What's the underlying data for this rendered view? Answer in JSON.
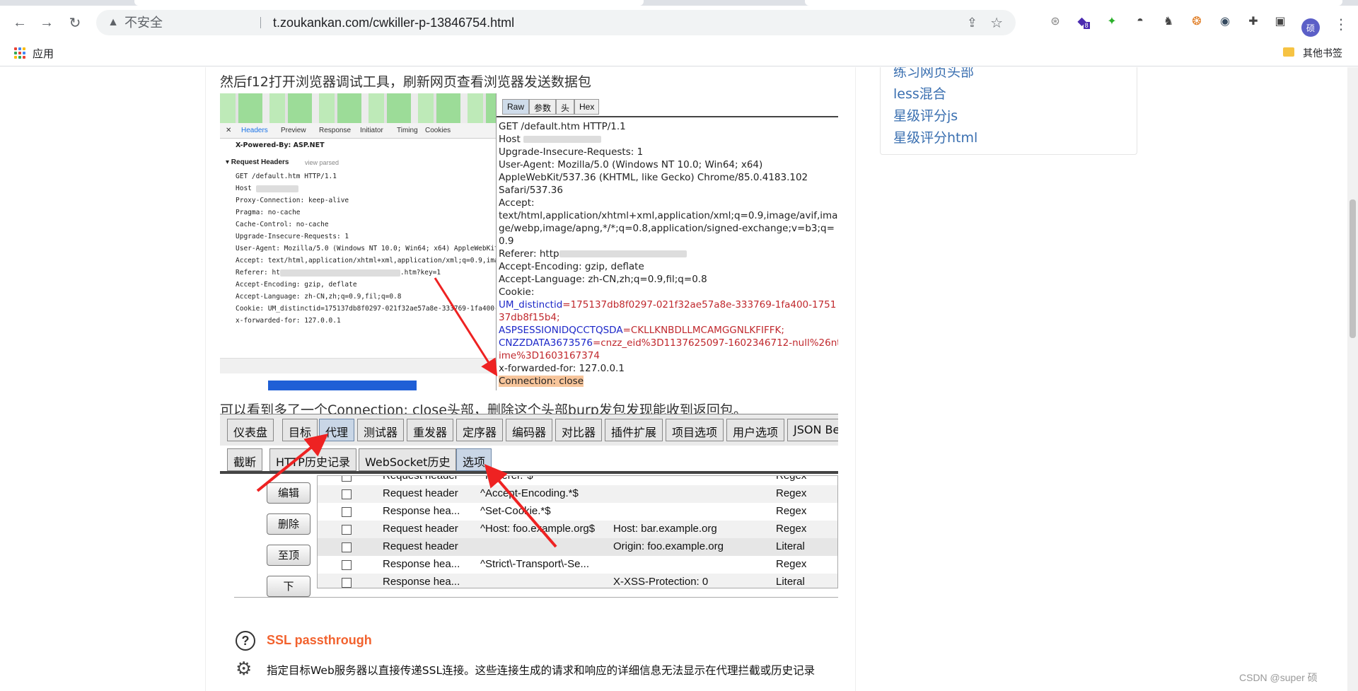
{
  "browser": {
    "insecure_label": "不安全",
    "url": "t.zoukankan.com/cwkiller-p-13846754.html",
    "apps_label": "应用",
    "other_bookmarks": "其他书签",
    "profile_initial": "硕",
    "ext_badge": "8"
  },
  "article": {
    "para1": "然后f12打开浏览器调试工具，刷新网页查看浏览器发送数据包",
    "para2": "可以看到多了一个Connection: close头部，删除这个头部burp发包发现能收到返回包。"
  },
  "sidebar": {
    "links": [
      "练习网页头部",
      "less混合",
      "星级评分js",
      "星级评分html"
    ]
  },
  "devtools": {
    "tabs": [
      "Headers",
      "Preview",
      "Response",
      "Initiator",
      "Timing",
      "Cookies"
    ],
    "powered_by": "X-Powered-By: ASP.NET",
    "section": "▾ Request Headers",
    "view_parsed": "view parsed",
    "lines": [
      "GET /default.htm HTTP/1.1",
      "Host",
      "Proxy-Connection: keep-alive",
      "Pragma: no-cache",
      "Cache-Control: no-cache",
      "Upgrade-Insecure-Requests: 1",
      "User-Agent: Mozilla/5.0 (Windows NT 10.0; Win64; x64) AppleWebKit/53",
      "Accept: text/html,application/xhtml+xml,application/xml;q=0.9,image/",
      "Referer: ht",
      "Accept-Encoding: gzip, deflate",
      "Accept-Language: zh-CN,zh;q=0.9,fil;q=0.8",
      "Cookie: UM_distinctid=175137db8f0297-021f32ae57a8e-333769-1fa400-175",
      "x-forwarded-for: 127.0.0.1"
    ],
    "referer_tail": ".htm?key=1"
  },
  "raw": {
    "tabs": [
      "Raw",
      "参数",
      "头",
      "Hex"
    ],
    "lines": [
      "GET /default.htm HTTP/1.1",
      "Host",
      "Upgrade-Insecure-Requests: 1",
      "User-Agent: Mozilla/5.0 (Windows NT 10.0; Win64; x64)",
      "AppleWebKit/537.36 (KHTML, like Gecko) Chrome/85.0.4183.102",
      "Safari/537.36",
      "Accept:",
      "text/html,application/xhtml+xml,application/xml;q=0.9,image/avif,ima",
      "ge/webp,image/apng,*/*;q=0.8,application/signed-exchange;v=b3;q=",
      "0.9",
      "Referer: http",
      "Accept-Encoding: gzip, deflate",
      "Accept-Language: zh-CN,zh;q=0.9,fil;q=0.8",
      "Cookie:"
    ],
    "ck1_name": "UM_distinctid",
    "ck1_val": "=175137db8f0297-021f32ae57a8e-333769-1fa400-1751",
    "ck1_val2": "37db8f15b4;",
    "ck2_name": "ASPSESSIONIDQCCTQSDA",
    "ck2_val": "=CKLLKNBDLLMCAMGGNLKFIFFK;",
    "ck3_name": "CNZZDATA3673576",
    "ck3_val": "=cnzz_eid%3D1137625097-1602346712-null%26nt",
    "ck3_val2": "ime%3D1603167374",
    "xff": "x-forwarded-for: 127.0.0.1",
    "connection": "Connection: close"
  },
  "burp": {
    "main_tabs": [
      "仪表盘",
      "目标",
      "代理",
      "测试器",
      "重发器",
      "定序器",
      "编码器",
      "对比器",
      "插件扩展",
      "项目选项",
      "用户选项",
      "JSON Be"
    ],
    "sub_tabs": [
      "截断",
      "HTTP历史记录",
      "WebSocket历史",
      "选项"
    ],
    "side_buttons": [
      "编辑",
      "删除",
      "至顶",
      "下"
    ],
    "rows": [
      {
        "item": "Request header",
        "match": "^Referer.*$",
        "replace": "",
        "type": "Regex"
      },
      {
        "item": "Request header",
        "match": "^Accept-Encoding.*$",
        "replace": "",
        "type": "Regex"
      },
      {
        "item": "Response hea...",
        "match": "^Set-Cookie.*$",
        "replace": "",
        "type": "Regex"
      },
      {
        "item": "Request header",
        "match": "^Host: foo.example.org$",
        "replace": "Host: bar.example.org",
        "type": "Regex"
      },
      {
        "item": "Request header",
        "match": "",
        "replace": "Origin: foo.example.org",
        "type": "Literal"
      },
      {
        "item": "Response hea...",
        "match": "^Strict\\-Transport\\-Se...",
        "replace": "",
        "type": "Regex"
      },
      {
        "item": "Response hea...",
        "match": "",
        "replace": "X-XSS-Protection: 0",
        "type": "Literal"
      }
    ],
    "ssl_title": "SSL passthrough",
    "ssl_desc": "指定目标Web服务器以直接传递SSL连接。这些连接生成的请求和响应的详细信息无法显示在代理拦截或历史记录"
  },
  "watermark": "CSDN @super  硕"
}
